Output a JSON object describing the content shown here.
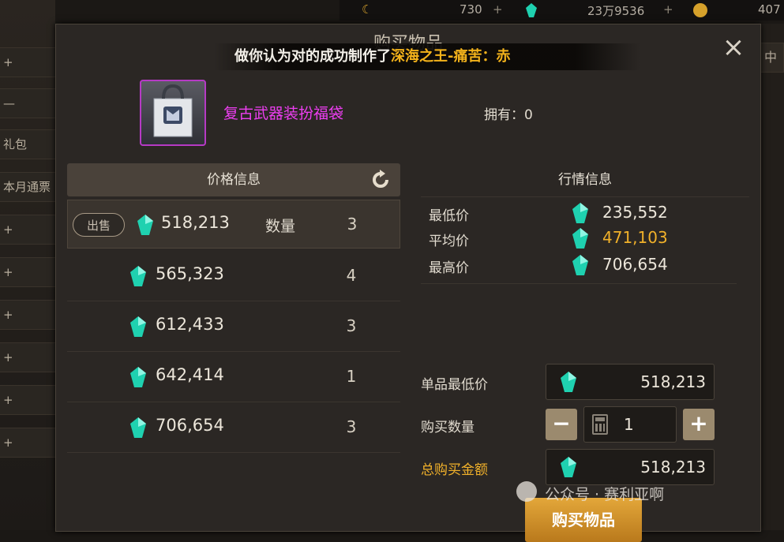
{
  "dialog": {
    "title": "购买物品",
    "close_label": "×"
  },
  "toast": {
    "text": "做你认为对的成功制作了",
    "highlight": "深海之王-痛苦：赤"
  },
  "item": {
    "name": "复古武器装扮福袋",
    "owned": "拥有：0"
  },
  "price_info": {
    "title": "价格信息",
    "sell_label": "出售",
    "qty_label": "数量",
    "listings": [
      {
        "price": "518,213",
        "qty": "3"
      },
      {
        "price": "565,323",
        "qty": "4"
      },
      {
        "price": "612,433",
        "qty": "3"
      },
      {
        "price": "642,414",
        "qty": "1"
      },
      {
        "price": "706,654",
        "qty": "3"
      }
    ]
  },
  "market": {
    "title": "行情信息",
    "rows": [
      {
        "label": "最低价",
        "value": "235,552",
        "color": "#ece6da"
      },
      {
        "label": "平均价",
        "value": "471,103",
        "color": "#f1b12a"
      },
      {
        "label": "最高价",
        "value": "706,654",
        "color": "#ece6da"
      }
    ]
  },
  "purchase": {
    "unit_min_label": "单品最低价",
    "unit_min_value": "518,213",
    "qty_label": "购买数量",
    "qty_value": "1",
    "minus": "−",
    "plus": "+",
    "total_label": "总购买金额",
    "total_value": "518,213",
    "buy_button": "购买物品"
  },
  "topbar": {
    "v1": "730",
    "v2": "23万9536",
    "v3": "407"
  },
  "background": {
    "left_strips": [
      "礼包",
      "本月通票"
    ],
    "right_strip": "中"
  },
  "watermark": "公众号 · 赛利亚啊",
  "colors": {
    "gem": "#1fd1b0",
    "accent_gold": "#f1b12a",
    "item_purple": "#ec3ef0"
  },
  "icons": [
    "close-icon",
    "refresh-icon",
    "gem-icon",
    "calculator-icon",
    "bag-icon",
    "coin-icon",
    "moon-icon"
  ]
}
